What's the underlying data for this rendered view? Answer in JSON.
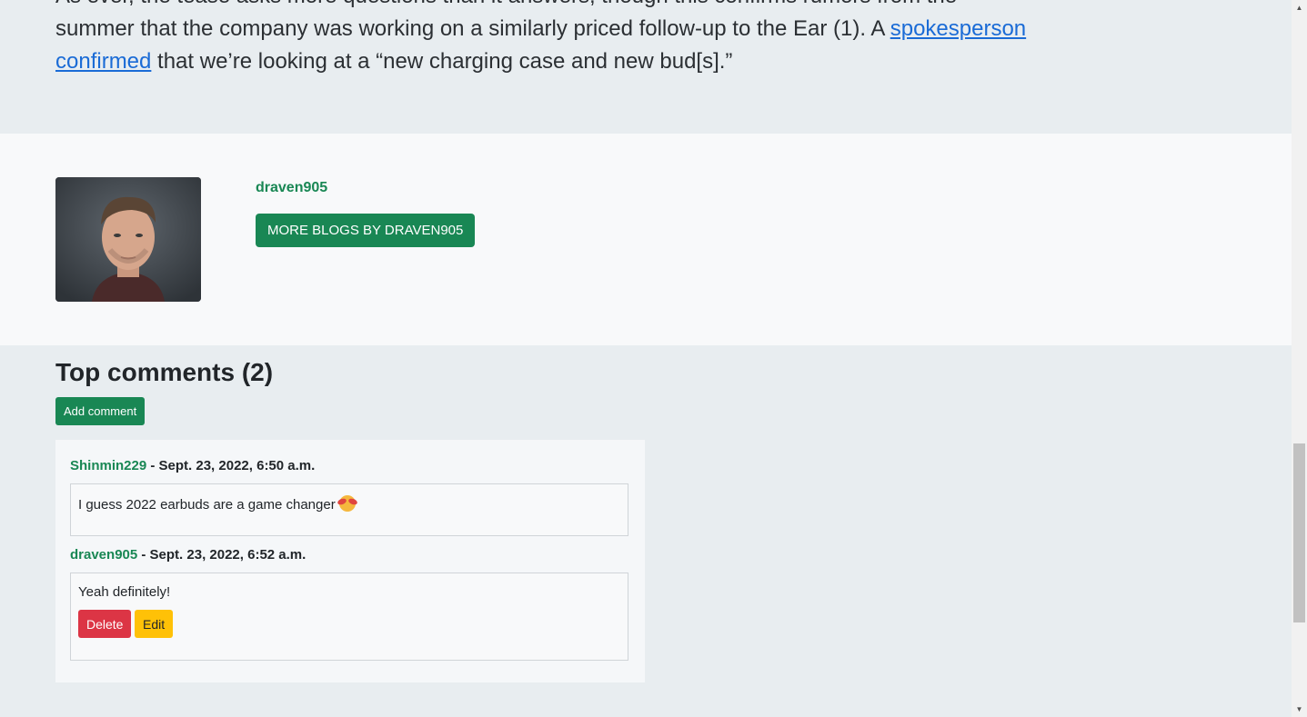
{
  "article": {
    "line1": "As ever, the tease asks more questions than it answers, though this confirms rumors from the",
    "line2_before": "summer that the company was working on a similarly priced follow-up to the Ear (1). A ",
    "link_text": "spokesperson confirmed",
    "line2_after": " that we’re looking at a “new charging case and new bud[s].”"
  },
  "author": {
    "name": "draven905",
    "more_button": "MORE BLOGS BY DRAVEN905"
  },
  "comments": {
    "heading": "Top comments (2)",
    "add_button": "Add comment",
    "items": [
      {
        "user": "Shinmin229",
        "date": " - Sept. 23, 2022, 6:50 a.m.",
        "text": "I guess 2022 earbuds are a game changer",
        "emoji": "smiling-face-with-hearts-icon"
      },
      {
        "user": "draven905",
        "date": " - Sept. 23, 2022, 6:52 a.m.",
        "text": "Yeah definitely!",
        "delete_label": "Delete",
        "edit_label": "Edit"
      }
    ]
  },
  "colors": {
    "accent": "#198754",
    "danger": "#dc3545",
    "warning": "#ffc107",
    "link": "#1a6bd6"
  }
}
